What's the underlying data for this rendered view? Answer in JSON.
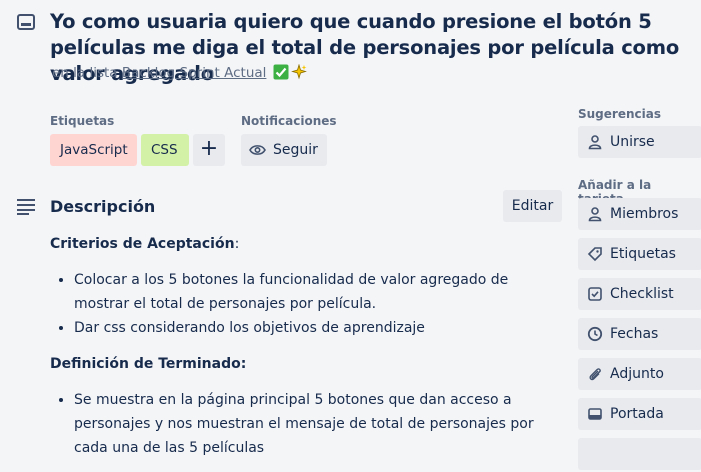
{
  "card": {
    "title": "Yo como usuaria quiero que cuando presione el botón 5 películas me diga el total de personajes por película como valor agregado",
    "in_list_prefix": "en la lista",
    "list_name": "Backlog Sprint Actual"
  },
  "labels": {
    "heading": "Etiquetas",
    "items": [
      {
        "text": "JavaScript",
        "bg": "#ffd5d2",
        "fg": "#172b4d"
      },
      {
        "text": "CSS",
        "bg": "#d3f1a7",
        "fg": "#172b4d"
      }
    ],
    "add_symbol": "+"
  },
  "notifications": {
    "heading": "Notificaciones",
    "follow_label": "Seguir"
  },
  "description": {
    "heading": "Descripción",
    "edit_label": "Editar",
    "criteria_heading": "Criterios de Aceptación",
    "criteria_suffix": ":",
    "criteria": [
      "Colocar a los 5 botones la funcionalidad de valor agregado de mostrar el total de personajes por película.",
      "Dar css considerando los objetivos de aprendizaje"
    ],
    "done_heading": "Definición de Terminado:",
    "done": [
      "Se muestra en la página principal 5 botones que dan acceso a personajes y nos muestran el mensaje de total de personajes por cada una de las 5 películas"
    ]
  },
  "sidebar": {
    "suggestions_heading": "Sugerencias",
    "join_label": "Unirse",
    "add_heading": "Añadir a la tarjeta",
    "items": [
      {
        "label": "Miembros",
        "icon": "person-icon"
      },
      {
        "label": "Etiquetas",
        "icon": "tag-icon"
      },
      {
        "label": "Checklist",
        "icon": "checkbox-icon"
      },
      {
        "label": "Fechas",
        "icon": "clock-icon"
      },
      {
        "label": "Adjunto",
        "icon": "paperclip-icon"
      },
      {
        "label": "Portada",
        "icon": "cover-icon"
      }
    ]
  }
}
